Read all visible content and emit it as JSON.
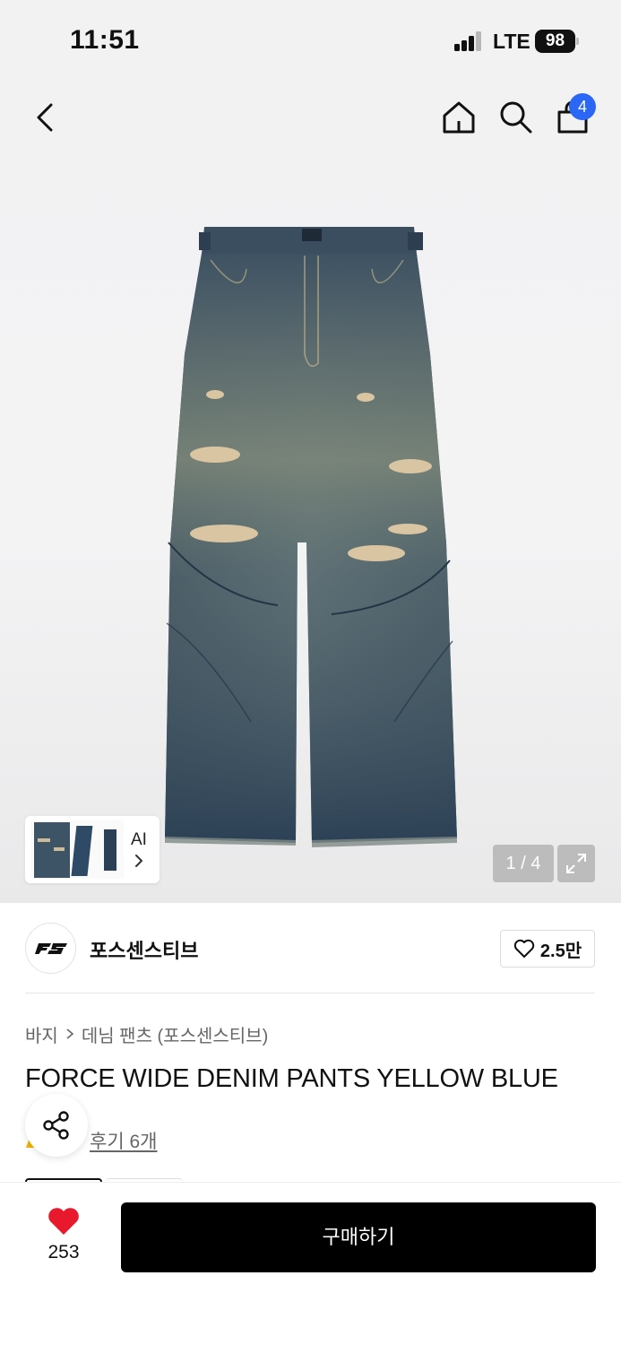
{
  "status_bar": {
    "time": "11:51",
    "network": "LTE",
    "battery": "98"
  },
  "nav": {
    "cart_count": "4"
  },
  "gallery": {
    "ai_label": "AI",
    "page_indicator": "1 / 4"
  },
  "brand": {
    "name": "포스센스티브",
    "likes": "2.5만"
  },
  "breadcrumb": {
    "category": "바지",
    "subcategory": "데님 팬츠 (포스센스티브)"
  },
  "product": {
    "title": "FORCE WIDE DENIM PANTS YELLOW BLUE",
    "reviews": "후기 6개"
  },
  "bottom": {
    "wish_count": "253",
    "buy_label": "구매하기"
  },
  "colors": {
    "accent_badge": "#2a67f5",
    "heart": "#e8192c",
    "buy_button": "#000000"
  },
  "icons": [
    "back-icon",
    "home-icon",
    "search-icon",
    "shopping-bag-icon",
    "chevron-right-icon",
    "expand-icon",
    "heart-outline-icon",
    "share-icon",
    "heart-filled-icon"
  ]
}
